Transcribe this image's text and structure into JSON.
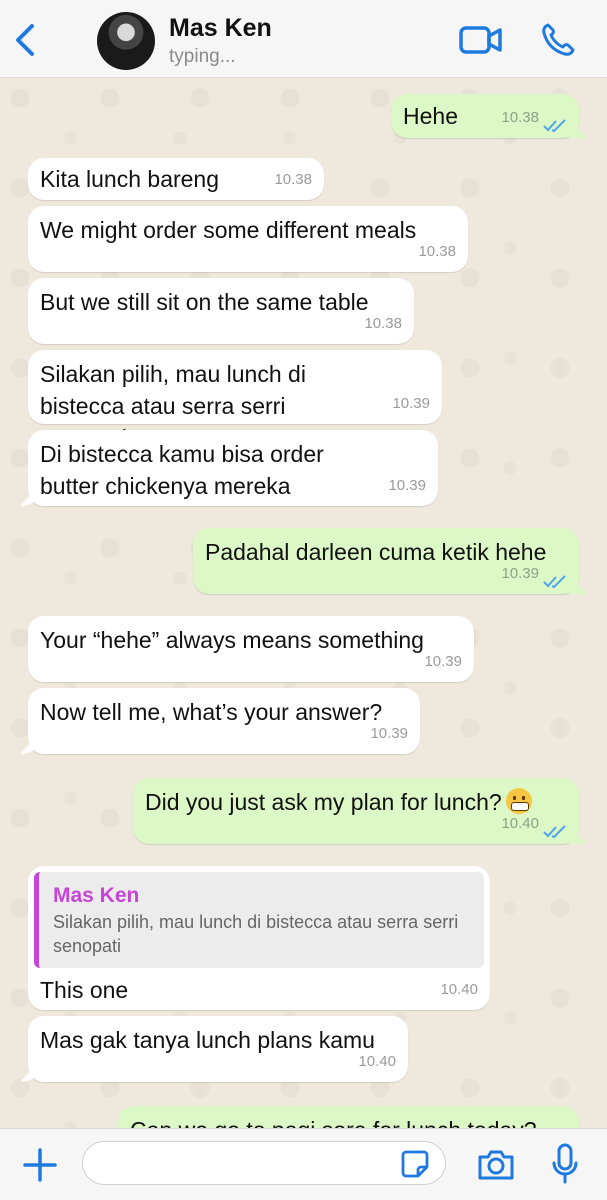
{
  "header": {
    "contact_name": "Mas Ken",
    "status": "typing...",
    "icons": {
      "back": "chevron-left-icon",
      "video": "video-camera-icon",
      "call": "phone-icon"
    },
    "accent_color": "#1f7ae0"
  },
  "messages": [
    {
      "direction": "out",
      "text": "Hehe",
      "time": "10.38",
      "read": true
    },
    {
      "direction": "in",
      "text": "Kita lunch bareng",
      "time": "10.38"
    },
    {
      "direction": "in",
      "text": "We might order some different meals",
      "time": "10.38"
    },
    {
      "direction": "in",
      "text": "But we still sit on the same table",
      "time": "10.38"
    },
    {
      "direction": "in",
      "text": "Silakan pilih, mau lunch di bistecca atau serra serri senopati",
      "time": "10.39"
    },
    {
      "direction": "in",
      "text": "Di bistecca kamu bisa order butter chickenya mereka",
      "time": "10.39"
    },
    {
      "direction": "out",
      "text": "Padahal darleen cuma ketik hehe",
      "time": "10.39",
      "read": true
    },
    {
      "direction": "in",
      "text": "Your “hehe” always means something",
      "time": "10.39"
    },
    {
      "direction": "in",
      "text": "Now tell me, what’s your answer?",
      "time": "10.39"
    },
    {
      "direction": "out",
      "text": "Did you just ask my plan for lunch?",
      "emoji": "grimacing-face",
      "time": "10.40",
      "read": true
    },
    {
      "direction": "in",
      "text": "This one",
      "time": "10.40",
      "quote": {
        "name": "Mas Ken",
        "text": "Silakan pilih, mau lunch di bistecca atau serra serri senopati"
      }
    },
    {
      "direction": "in",
      "text": "Mas gak tanya lunch plans kamu",
      "time": "10.40"
    },
    {
      "direction": "out",
      "text": "Can we go to pagi sore for lunch today?",
      "partial": true
    }
  ],
  "composer": {
    "placeholder": "",
    "icons": {
      "add": "plus-icon",
      "sticker": "sticker-icon",
      "camera": "camera-icon",
      "mic": "microphone-icon"
    }
  },
  "colors": {
    "incoming": "#ffffff",
    "outgoing": "#dcf8c6",
    "read_ticks": "#4fa6e8",
    "quote_accent": "#c545d4"
  }
}
